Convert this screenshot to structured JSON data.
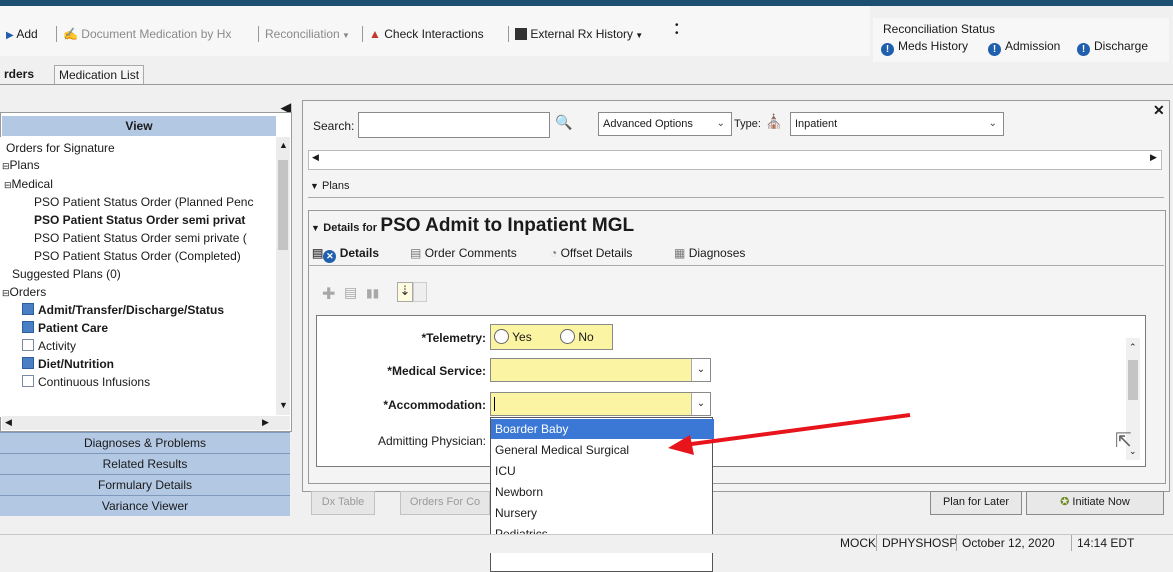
{
  "toolbar": {
    "add": "Add",
    "document_med": "Document Medication by Hx",
    "reconciliation": "Reconciliation",
    "check_interactions": "Check Interactions",
    "external_rx": "External Rx History"
  },
  "recon_status": {
    "title": "Reconciliation Status",
    "items": [
      "Meds History",
      "Admission",
      "Discharge"
    ]
  },
  "tabs": [
    "rders",
    "Medication List"
  ],
  "left_panel": {
    "view_header": "View",
    "tree": [
      "Orders for Signature",
      "Plans",
      "Medical",
      "PSO Patient Status Order (Planned Penc",
      "PSO Patient Status Order semi privat",
      "PSO Patient Status Order semi private (",
      "PSO Patient Status Order (Completed)",
      "Suggested Plans (0)",
      "Orders",
      "Admit/Transfer/Discharge/Status",
      "Patient Care",
      "Activity",
      "Diet/Nutrition",
      "Continuous Infusions"
    ],
    "sections": [
      "Diagnoses & Problems",
      "Related Results",
      "Formulary Details",
      "Variance Viewer"
    ]
  },
  "search": {
    "label": "Search:",
    "value": "",
    "advanced": "Advanced Options",
    "type_label": "Type:",
    "type_value": "Inpatient"
  },
  "plans_label": "Plans",
  "details": {
    "prefix": "Details for",
    "title": "PSO Admit to Inpatient MGL",
    "tabs": [
      "Details",
      "Order Comments",
      "Offset Details",
      "Diagnoses"
    ]
  },
  "form": {
    "telemetry_label": "*Telemetry:",
    "yes": "Yes",
    "no": "No",
    "medical_service_label": "*Medical Service:",
    "accommodation_label": "*Accommodation:",
    "admitting_label": "Admitting Physician:"
  },
  "dropdown": {
    "options": [
      "Boarder Baby",
      "General Medical Surgical",
      "ICU",
      "Newborn",
      "Nursery",
      "Pediatrics"
    ],
    "highlighted": "Boarder Baby"
  },
  "buttons": {
    "dx_table": "Dx Table",
    "orders_for": "Orders For Co",
    "plan_later": "Plan for Later",
    "initiate_now": "Initiate Now"
  },
  "status_bar": {
    "env": "MOCK",
    "user": "DPHYSHOSP",
    "date": "October 12, 2020",
    "time": "14:14 EDT"
  },
  "colors": {
    "header_blue": "#b3c8e3",
    "required_yellow": "#fbf4a2",
    "selection_blue": "#3b78d6",
    "arrow_red": "#e8141b"
  }
}
